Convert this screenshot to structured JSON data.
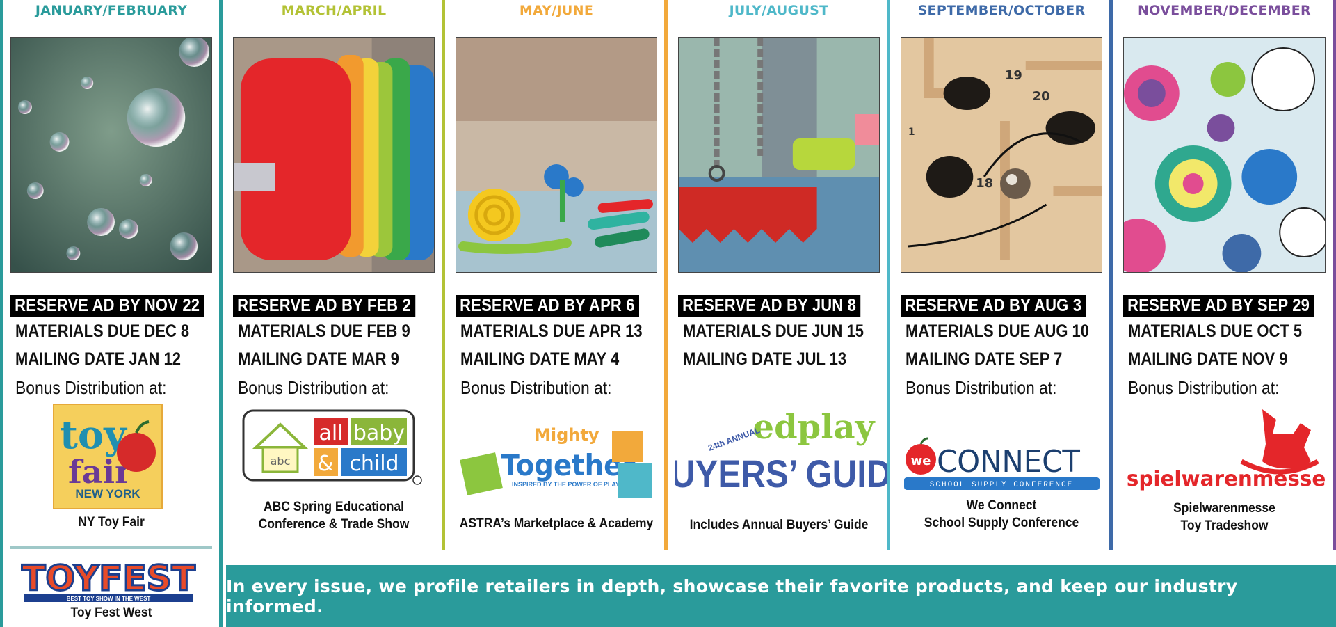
{
  "colors": {
    "jan_feb": "#2a9b9b",
    "mar_apr": "#b3c235",
    "may_jun": "#f2a93b",
    "jul_aug": "#4fb8c9",
    "sep_oct": "#3e6aa8",
    "nov_dec": "#7a4e9c",
    "banner": "#2a9b9b"
  },
  "columns": [
    {
      "heading": "JANUARY/FEBRUARY",
      "reserve": "RESERVE AD BY NOV 22",
      "materials": "MATERIALS DUE DEC 8",
      "mailing": "MAILING DATE JAN 12",
      "bonus": "Bonus Distribution at:",
      "logo_text": [
        "toy",
        "fair",
        "NEW YORK"
      ],
      "caption": "NY Toy Fair",
      "logo2_text": [
        "TOYFEST",
        "BEST TOY SHOW IN THE WEST"
      ],
      "caption2": "Toy Fest West",
      "photo": "soap-bubbles-photo"
    },
    {
      "heading": "MARCH/APRIL",
      "reserve": "RESERVE AD BY FEB 2",
      "materials": "MATERIALS DUE FEB 9",
      "mailing": "MAILING DATE MAR 9",
      "bonus": "Bonus Distribution at:",
      "logo_text": [
        "all",
        "baby",
        "&",
        "child",
        "abc"
      ],
      "caption_lines": [
        "ABC Spring Educational",
        "Conference & Trade Show"
      ],
      "photo": "stacking-rings-photo"
    },
    {
      "heading": "MAY/JUNE",
      "reserve": "RESERVE AD BY APR 6",
      "materials": "MATERIALS DUE APR 13",
      "mailing": "MAILING DATE MAY 4",
      "bonus": "Bonus Distribution at:",
      "logo_text": [
        "Mighty",
        "Together",
        "INSPIRED BY THE POWER OF PLAY"
      ],
      "caption": "ASTRA’s Marketplace & Academy",
      "photo": "modeling-clay-photo"
    },
    {
      "heading": "JULY/AUGUST",
      "reserve": "RESERVE AD BY JUN 8",
      "materials": "MATERIALS DUE JUN 15",
      "mailing": "MAILING DATE JUL 13",
      "logo_text": [
        "edplay",
        "24th ANNUAL",
        "BUYERS’ GUIDE"
      ],
      "caption": "Includes Annual Buyers’ Guide",
      "photo": "swings-photo"
    },
    {
      "heading": "SEPTEMBER/OCTOBER",
      "reserve": "RESERVE AD BY AUG 3",
      "materials": "MATERIALS DUE AUG 10",
      "mailing": "MAILING DATE SEP 7",
      "bonus": "Bonus Distribution at:",
      "logo_text": [
        "we",
        "CONNECT",
        "SCHOOL SUPPLY CONFERENCE"
      ],
      "caption_lines": [
        "We Connect",
        "School Supply Conference"
      ],
      "photo": "wooden-maze-photo",
      "photo_numbers": [
        "19",
        "20",
        "18",
        "1"
      ]
    },
    {
      "heading": "NOVEMBER/DECEMBER",
      "reserve": "RESERVE AD BY SEP 29",
      "materials": "MATERIALS DUE OCT 5",
      "mailing": "MAILING DATE NOV 9",
      "bonus": "Bonus Distribution at:",
      "logo_text": [
        "spielwarenmesse"
      ],
      "caption_lines": [
        "Spielwarenmesse",
        "Toy Tradeshow"
      ],
      "photo": "coloring-pattern-photo"
    }
  ],
  "banner": "In every issue, we profile retailers in depth, showcase their favorite products, and keep our industry informed."
}
